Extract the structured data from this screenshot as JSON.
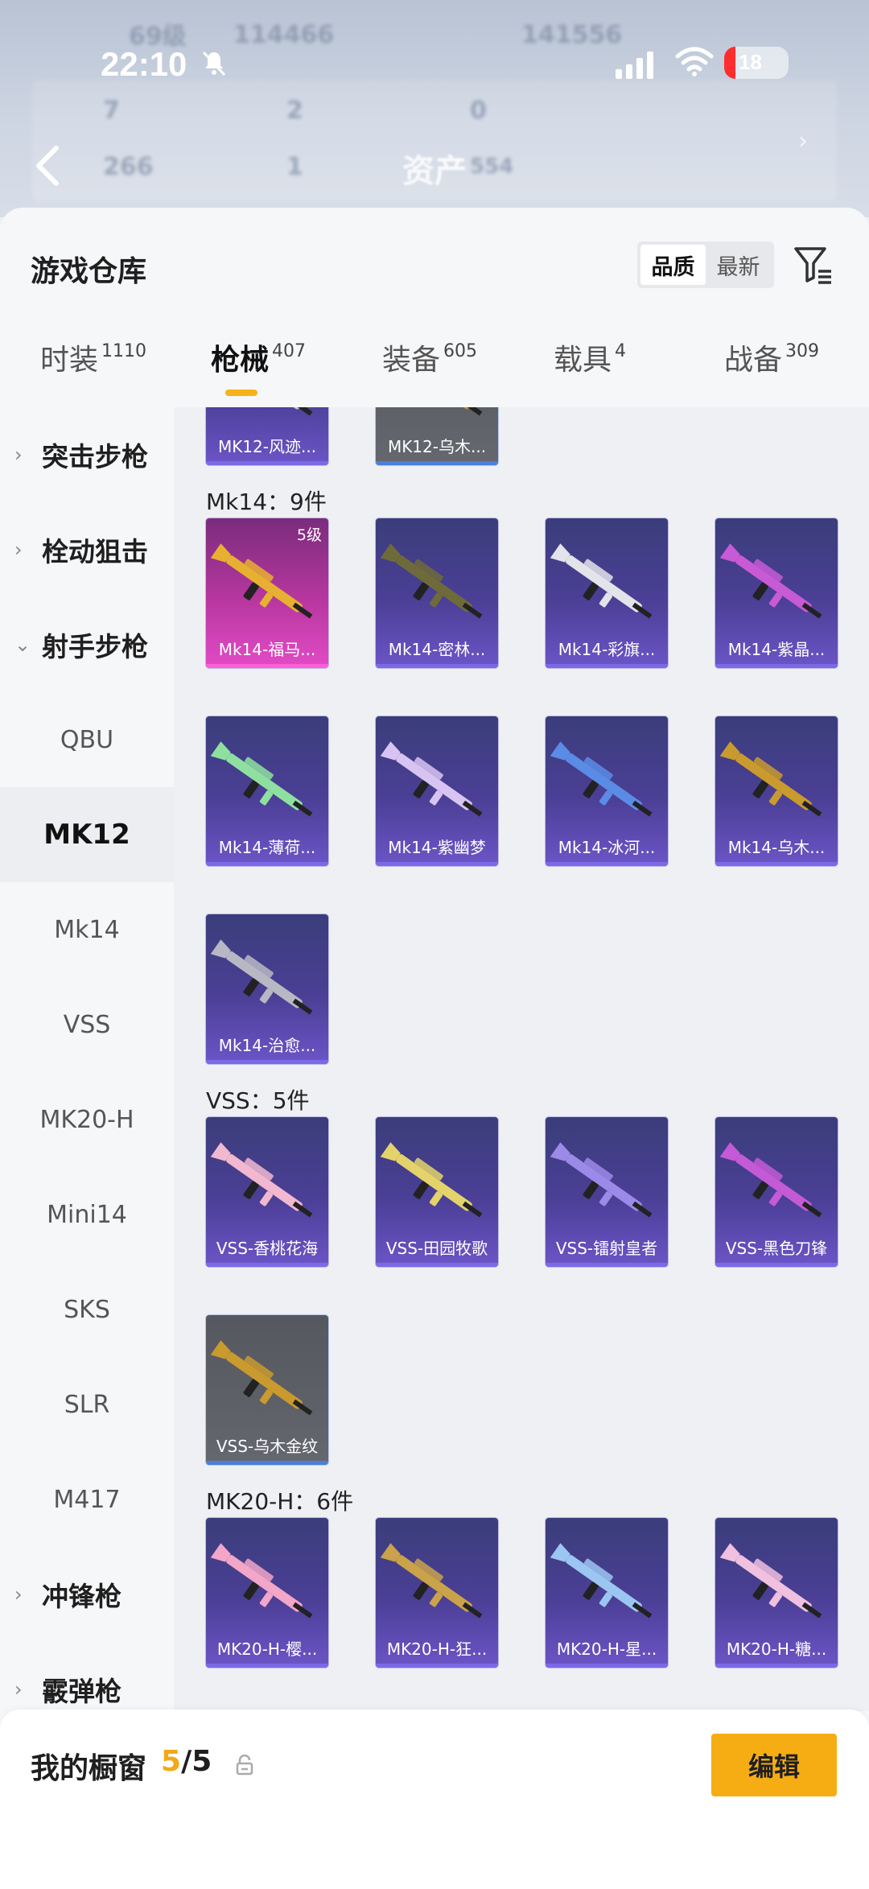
{
  "status_bar": {
    "time": "22:10",
    "battery_level": "18"
  },
  "header_blur": {
    "level_text": "69级",
    "coins": "114466",
    "score": "141556",
    "stats": [
      "7",
      "2",
      "0",
      "266",
      "1"
    ],
    "assets_label": "资产",
    "assets_value": "554"
  },
  "sheet": {
    "title": "游戏仓库",
    "sort_options": [
      {
        "label": "品质",
        "active": true
      },
      {
        "label": "最新",
        "active": false
      }
    ]
  },
  "tabs": [
    {
      "label": "时装",
      "count": "1110"
    },
    {
      "label": "枪械",
      "count": "407",
      "active": true
    },
    {
      "label": "装备",
      "count": "605"
    },
    {
      "label": "载具",
      "count": "4"
    },
    {
      "label": "战备",
      "count": "309"
    }
  ],
  "sidebar": [
    {
      "label": "突击步枪",
      "type": "category",
      "expanded": false
    },
    {
      "label": "栓动狙击",
      "type": "category",
      "expanded": false
    },
    {
      "label": "射手步枪",
      "type": "category",
      "expanded": true
    },
    {
      "label": "QBU",
      "type": "sub"
    },
    {
      "label": "MK12",
      "type": "sub",
      "active": true
    },
    {
      "label": "Mk14",
      "type": "sub"
    },
    {
      "label": "VSS",
      "type": "sub"
    },
    {
      "label": "MK20-H",
      "type": "sub"
    },
    {
      "label": "Mini14",
      "type": "sub"
    },
    {
      "label": "SKS",
      "type": "sub"
    },
    {
      "label": "SLR",
      "type": "sub"
    },
    {
      "label": "M417",
      "type": "sub"
    },
    {
      "label": "冲锋枪",
      "type": "category",
      "expanded": false
    },
    {
      "label": "霰弹枪",
      "type": "category",
      "expanded": false
    }
  ],
  "sections": [
    {
      "title": "",
      "items": [
        {
          "label": "MK12-风迹...",
          "style": "purple",
          "color": "#c9c9d8"
        },
        {
          "label": "MK12-乌木...",
          "style": "gray",
          "color": "#b8902a"
        }
      ]
    },
    {
      "title": "Mk14：9件",
      "items": [
        {
          "label": "Mk14-福马...",
          "style": "pink",
          "level": "5级",
          "color": "#e8b030"
        },
        {
          "label": "Mk14-密林...",
          "style": "purple",
          "color": "#6f6a3a"
        },
        {
          "label": "Mk14-彩旗...",
          "style": "purple",
          "color": "#e3e3ea"
        },
        {
          "label": "Mk14-紫晶...",
          "style": "purple",
          "color": "#c85ad6"
        },
        {
          "label": "Mk14-薄荷...",
          "style": "purple",
          "color": "#8fe0a0"
        },
        {
          "label": "Mk14-紫幽梦",
          "style": "purple",
          "color": "#d8c4f2"
        },
        {
          "label": "Mk14-冰河...",
          "style": "purple",
          "color": "#5a8ce6"
        },
        {
          "label": "Mk14-乌木...",
          "style": "purple",
          "color": "#c99a2e"
        },
        {
          "label": "Mk14-治愈...",
          "style": "purple",
          "color": "#b8b8c4"
        }
      ]
    },
    {
      "title": "VSS：5件",
      "items": [
        {
          "label": "VSS-香桃花海",
          "style": "purple",
          "color": "#f2b8cf"
        },
        {
          "label": "VSS-田园牧歌",
          "style": "purple",
          "color": "#e3d36a"
        },
        {
          "label": "VSS-镭射皇者",
          "style": "purple",
          "color": "#9c8ae8"
        },
        {
          "label": "VSS-黑色刀锋",
          "style": "purple",
          "color": "#c45ad6"
        },
        {
          "label": "VSS-乌木金纹",
          "style": "gray",
          "color": "#c99a2e"
        }
      ]
    },
    {
      "title": "MK20-H：6件",
      "items": [
        {
          "label": "MK20-H-樱...",
          "style": "purple",
          "color": "#f2a6c8"
        },
        {
          "label": "MK20-H-狂...",
          "style": "purple",
          "color": "#c9a24a"
        },
        {
          "label": "MK20-H-星...",
          "style": "purple",
          "color": "#9cc6f2"
        },
        {
          "label": "MK20-H-糖...",
          "style": "purple",
          "color": "#f0c0e0"
        }
      ]
    }
  ],
  "bottom_bar": {
    "label": "我的橱窗",
    "current": "5",
    "separator": "/",
    "total": "5",
    "edit_label": "编辑"
  },
  "colors": {
    "accent": "#f6ad14",
    "card_purple": "#4b3f96",
    "card_pink": "#b8379f",
    "card_gray": "#5e6068"
  }
}
